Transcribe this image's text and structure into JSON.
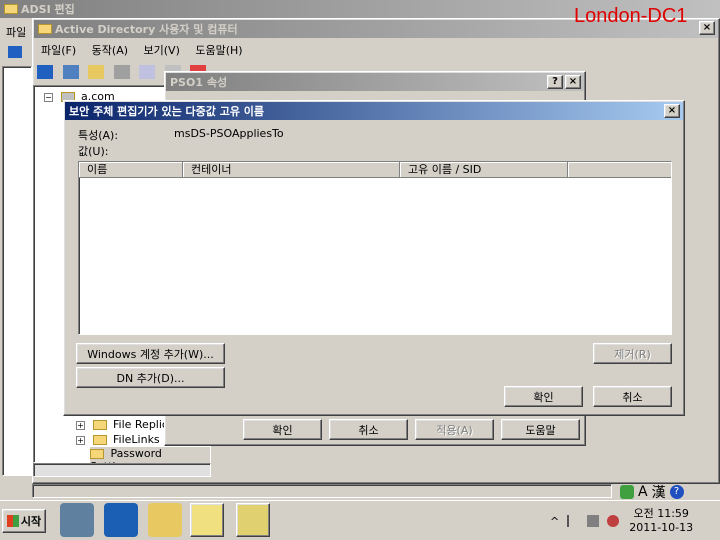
{
  "adsi": {
    "title": "ADSI 편집",
    "menu_first": "파일"
  },
  "aduc": {
    "title": "Active Directory 사용자 및 컴퓨터",
    "menu": [
      "파일(F)",
      "동작(A)",
      "보기(V)",
      "도움말(H)"
    ],
    "tree_root": "a.com",
    "tree_items": [
      "File Replica",
      "FileLinks",
      "Password Settings"
    ]
  },
  "watermark": "London-DC1",
  "pso_dialog": {
    "title": "PSO1 속성",
    "help_btn": "?",
    "ok": "확인",
    "cancel": "취소",
    "apply": "적용(A)",
    "help": "도움말"
  },
  "editor": {
    "title": "보안 주체 편집기가 있는 다중값 고유 이름",
    "attribute_label": "특성(A):",
    "attribute_value": "msDS-PSOAppliesTo",
    "values_label": "값(U):",
    "columns": [
      "이름",
      "컨테이너",
      "고유 이름 / SID"
    ],
    "add_windows": "Windows 계정 추가(W)...",
    "add_dn": "DN 추가(D)...",
    "remove": "제거(R)",
    "ok": "확인",
    "cancel": "취소"
  },
  "taskbar": {
    "start": "시작",
    "time": "오전 11:59",
    "date": "2011-10-13",
    "ime_a": "A",
    "ime_han": "漢"
  }
}
